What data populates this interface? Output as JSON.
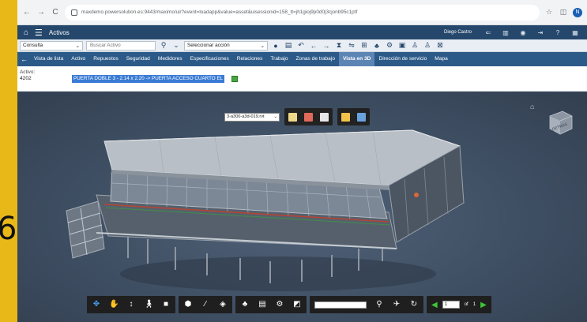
{
  "browser": {
    "url": "maxdemo.powersolution.es:9443/maximo/ui/?event=loadapp&value=asset&uisessionid=158_tt=jh1gioj9p0d0j3cjonb95c1ptf",
    "nav_back": "←",
    "nav_forward": "→",
    "nav_reload": "C"
  },
  "app": {
    "title": "Activos",
    "user": "Diego Castro"
  },
  "toolbar": {
    "query_value": "Consulta",
    "search_placeholder": "Buscar Activo",
    "action_value": "Seleccionar acción"
  },
  "tabs": [
    {
      "label": "Vista de lista",
      "active": false
    },
    {
      "label": "Activo",
      "active": false
    },
    {
      "label": "Repuestos",
      "active": false
    },
    {
      "label": "Seguridad",
      "active": false
    },
    {
      "label": "Medidores",
      "active": false
    },
    {
      "label": "Especificaciones",
      "active": false
    },
    {
      "label": "Relaciones",
      "active": false
    },
    {
      "label": "Trabajo",
      "active": false
    },
    {
      "label": "Zonas de trabajo",
      "active": false
    },
    {
      "label": "Vista en 3D",
      "active": true
    },
    {
      "label": "Dirección de servicio",
      "active": false
    },
    {
      "label": "Mapa",
      "active": false
    }
  ],
  "record": {
    "label": "Activo:",
    "asset_num": "4202",
    "description": "PUERTA DOBLE 3 - 2.14 x 2.20 -> PUERTA ACCESO CUARTO EL"
  },
  "viewer": {
    "model_file": "3-a300-a3d-019.rvt",
    "page_current": "1",
    "page_of": "of",
    "page_total": "1",
    "viewcube_label": "DETRÁS"
  },
  "page_edge": {
    "digit": "6"
  },
  "colors": {
    "title_bar": "#25476c",
    "tab_bar": "#2c5a88",
    "active_tab": "#5c85b5",
    "selection": "#3a7bd5",
    "viewer_bg": "#46566b"
  }
}
